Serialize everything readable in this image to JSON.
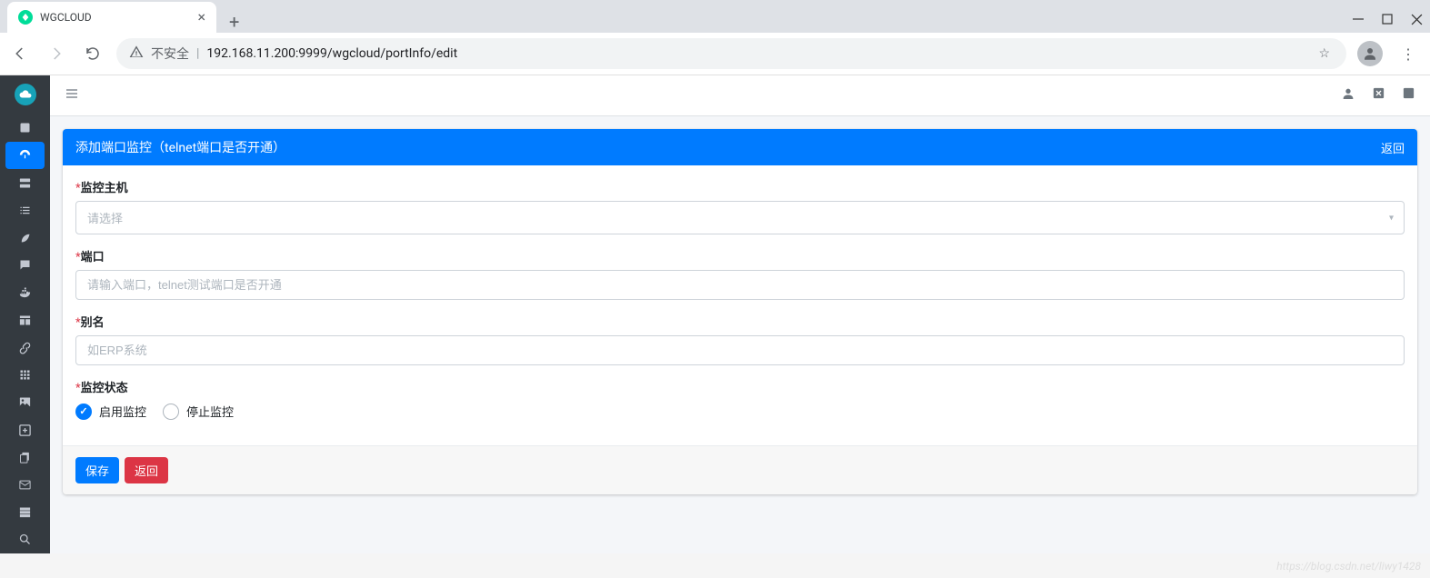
{
  "browser": {
    "tab_title": "WGCLOUD",
    "security_label": "不安全",
    "url": "192.168.11.200:9999/wgcloud/portInfo/edit"
  },
  "card": {
    "title": "添加端口监控（telnet端口是否开通）",
    "back_label": "返回"
  },
  "form": {
    "host": {
      "label": "监控主机",
      "placeholder": "请选择"
    },
    "port": {
      "label": "端口",
      "placeholder": "请输入端口，telnet测试端口是否开通"
    },
    "alias": {
      "label": "别名",
      "placeholder": "如ERP系统"
    },
    "status": {
      "label": "监控状态",
      "option_enable": "启用监控",
      "option_disable": "停止监控"
    }
  },
  "footer": {
    "save_label": "保存",
    "back_label": "返回"
  },
  "watermark": "https://blog.csdn.net/liwy1428"
}
